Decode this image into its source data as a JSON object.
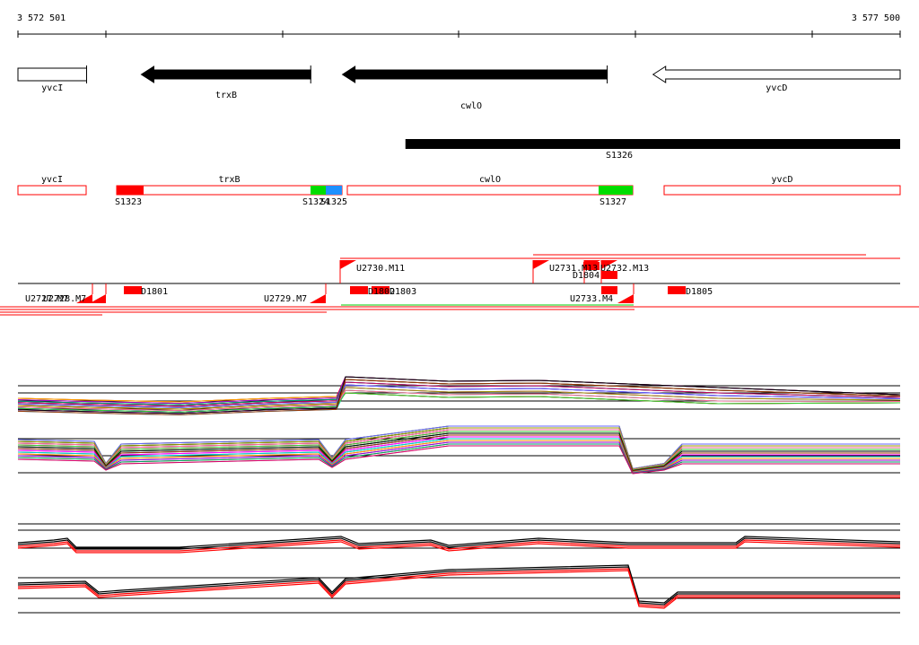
{
  "ruler": {
    "start_label": "3 572 501",
    "end_label": "3 577 500",
    "start": 3572501,
    "end": 3577500
  },
  "genes": [
    {
      "name": "yvcI",
      "start": 3572501,
      "end": 3572890,
      "strand": "+",
      "fill": "#ffffff"
    },
    {
      "name": "trxB",
      "start": 3573200,
      "end": 3574160,
      "strand": "-",
      "fill": "#000000"
    },
    {
      "name": "cwlO",
      "start": 3574340,
      "end": 3575840,
      "strand": "-",
      "fill": "#000000"
    },
    {
      "name": "yvcD",
      "start": 3576100,
      "end": 3577500,
      "strand": "-",
      "fill": "#ffffff"
    }
  ],
  "transcript": {
    "label": "S1326",
    "start": 3574300,
    "end": 3577500
  },
  "segments": {
    "boxes": [
      {
        "name": "yvcI",
        "start": 3572501,
        "end": 3572890
      },
      {
        "name": "trxB",
        "start": 3573060,
        "end": 3574300
      },
      {
        "name": "cwlO",
        "start": 3574340,
        "end": 3575940
      },
      {
        "name": "yvcD",
        "start": 3576100,
        "end": 3577500
      }
    ],
    "markers": [
      {
        "label": "S1323",
        "start": 3573060,
        "end": 3573220,
        "color": "#ff0000"
      },
      {
        "label": "S1324",
        "start": 3574140,
        "end": 3574230,
        "color": "#00dd00"
      },
      {
        "label": "S1325",
        "start": 3574230,
        "end": 3574330,
        "color": "#1e90ff"
      },
      {
        "label": "S1327",
        "start": 3575740,
        "end": 3575940,
        "color": "#00dd00"
      }
    ]
  },
  "features": {
    "upper_labels": [
      {
        "text": "U2730.M11",
        "pos": 3574300
      },
      {
        "text": "U2731.M13",
        "pos": 3575350
      },
      {
        "text": "U2732.M13",
        "pos": 3575600
      },
      {
        "text": "D1804",
        "pos": 3575540
      }
    ],
    "lower_labels": [
      {
        "text": "U2727.M7",
        "pos": 3572510
      },
      {
        "text": "U2728.M7",
        "pos": 3572640
      },
      {
        "text": "D1801",
        "pos": 3573190
      },
      {
        "text": "U2729.M7",
        "pos": 3573880
      },
      {
        "text": "D1802",
        "pos": 3574520
      },
      {
        "text": "D1803",
        "pos": 3574600
      },
      {
        "text": "U2733.M4",
        "pos": 3575580
      },
      {
        "text": "D1805",
        "pos": 3576240
      }
    ],
    "red_blocks": [
      {
        "start": 3573100,
        "end": 3573190
      },
      {
        "start": 3574360,
        "end": 3574450
      },
      {
        "start": 3574490,
        "end": 3574600
      },
      {
        "start": 3575760,
        "end": 3575840
      },
      {
        "start": 3576220,
        "end": 3576300
      }
    ]
  },
  "colors": {
    "red": "#ff0000",
    "green": "#00dd00",
    "blue": "#1e90ff",
    "black": "#000000"
  }
}
